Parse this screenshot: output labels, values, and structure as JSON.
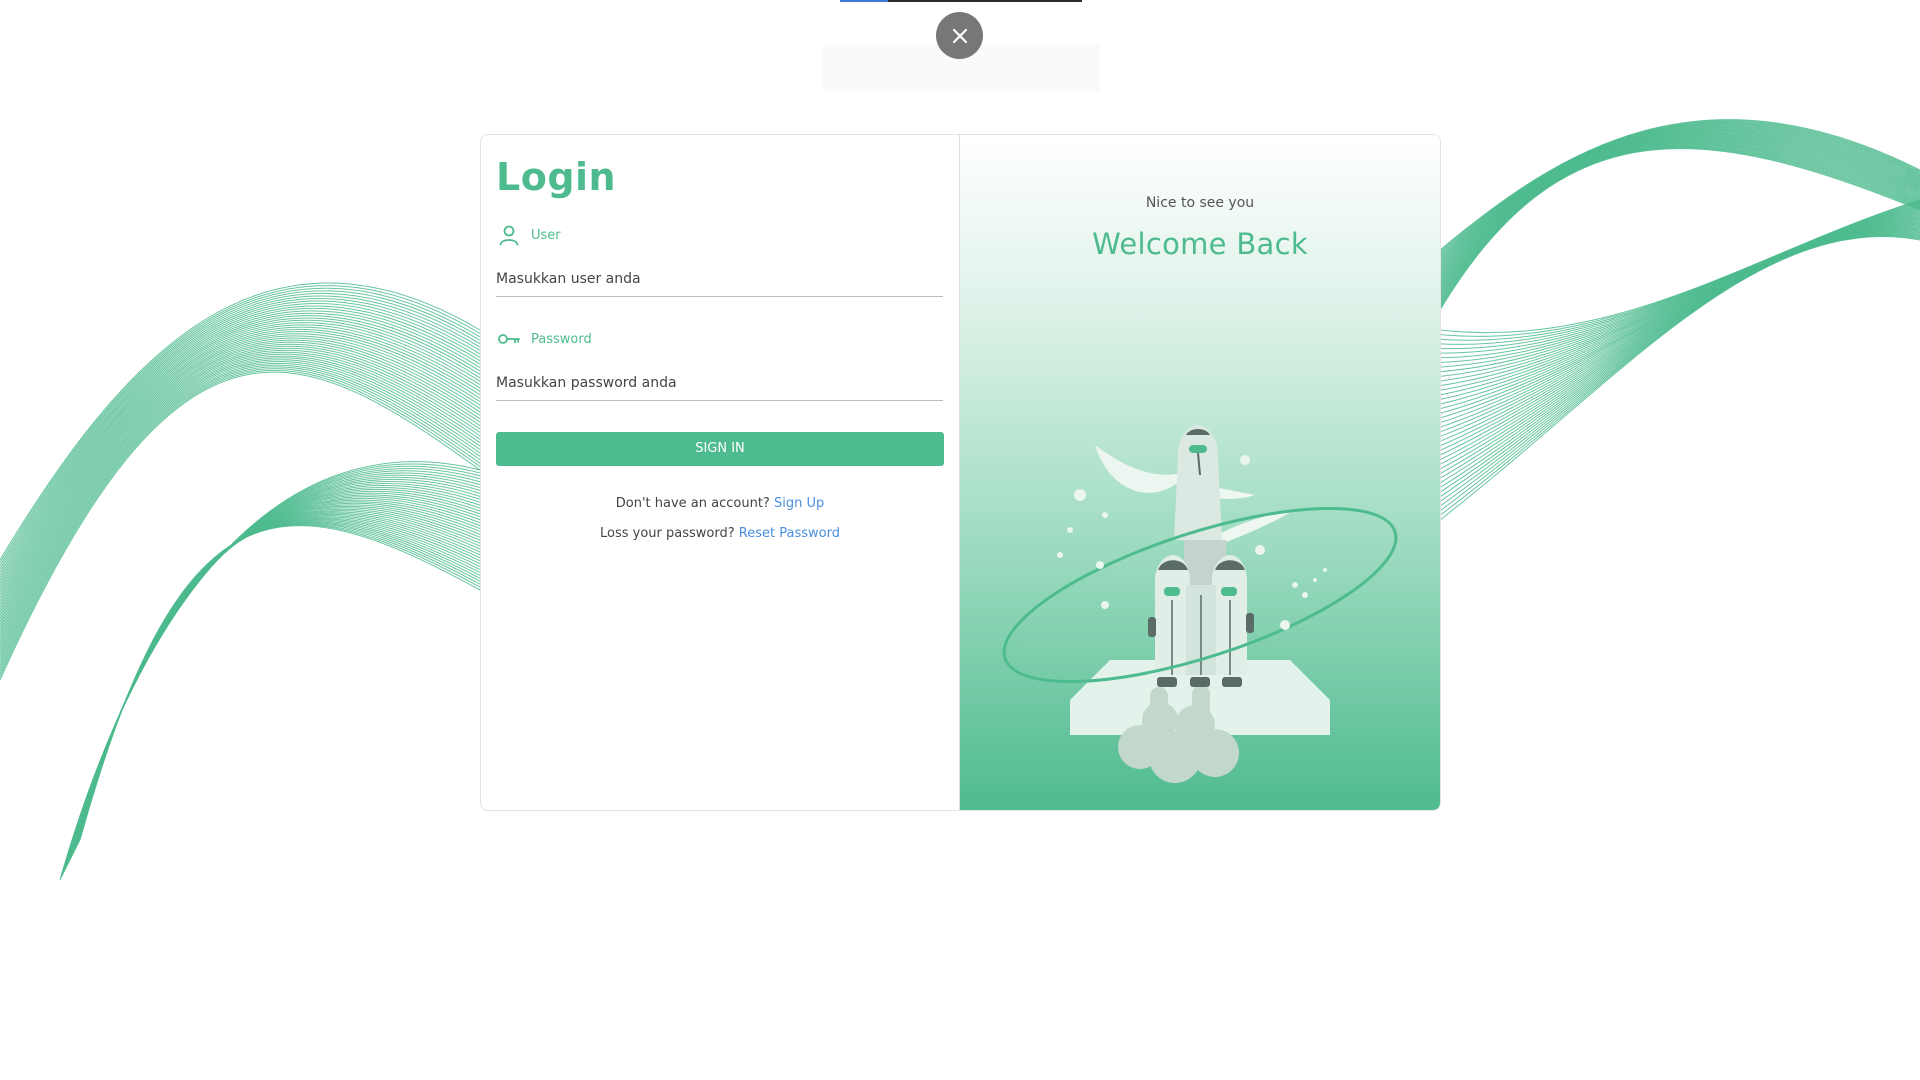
{
  "login": {
    "title": "Login",
    "user_label": "User",
    "user_placeholder": "Masukkan user anda",
    "password_label": "Password",
    "password_placeholder": "Masukkan password anda",
    "signin_label": "SIGN IN",
    "no_account_text": "Don't have an account?",
    "signup_link": "Sign Up",
    "lost_password_text": "Loss your password?",
    "reset_link": "Reset Password"
  },
  "welcome_panel": {
    "subtitle": "Nice to see you",
    "heading": "Welcome Back"
  },
  "page_progress": 0.2,
  "colors": {
    "accent": "#4dbb8e",
    "link": "#4a8fe0",
    "close_button": "#777777"
  },
  "icons": {
    "user_field": "person-icon",
    "password_field": "key-icon",
    "close": "close-icon"
  }
}
